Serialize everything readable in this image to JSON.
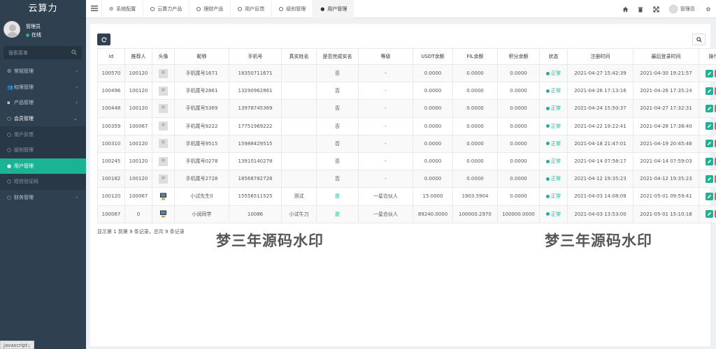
{
  "brand": "云算力",
  "user": {
    "name": "管理员",
    "status": "在线"
  },
  "sidebar": {
    "search_placeholder": "搜索菜单",
    "items": [
      {
        "label": "常规管理",
        "icon": "cogs-icon"
      },
      {
        "label": "权限管理",
        "icon": "users-icon"
      },
      {
        "label": "产品管理",
        "icon": "folder-icon"
      },
      {
        "label": "会员管理",
        "icon": "circle-icon"
      },
      {
        "label": "用户反馈",
        "icon": "circle-icon"
      },
      {
        "label": "级别管理",
        "icon": "circle-icon"
      },
      {
        "label": "用户管理",
        "icon": "user-icon"
      },
      {
        "label": "短信验证码",
        "icon": "circle-icon"
      },
      {
        "label": "财务管理",
        "icon": "circle-icon"
      }
    ]
  },
  "tabs": [
    {
      "label": "系统配置",
      "icon": "gear-icon"
    },
    {
      "label": "云算力产品",
      "icon": "circle-icon"
    },
    {
      "label": "理财产品",
      "icon": "circle-icon"
    },
    {
      "label": "用户反馈",
      "icon": "circle-icon"
    },
    {
      "label": "级别管理",
      "icon": "circle-icon"
    },
    {
      "label": "用户管理",
      "icon": "user-icon"
    }
  ],
  "topbar": {
    "user_label": "管理员"
  },
  "table": {
    "headers": [
      "Id",
      "推荐人",
      "头像",
      "昵称",
      "手机号",
      "真实姓名",
      "是否完成实名",
      "等级",
      "USDT余额",
      "FIL余额",
      "积分余额",
      "状态",
      "注册时间",
      "最后登录时间",
      "操作"
    ],
    "rows": [
      [
        "100570",
        "100120",
        "",
        "手机尾号1671",
        "18350711671",
        "",
        "否",
        "-",
        "0.0000",
        "0.0000",
        "0.0000",
        "正常",
        "2021-04-27 15:42:39",
        "2021-04-30 19:21:57"
      ],
      [
        "100496",
        "100120",
        "",
        "手机尾号2861",
        "13290962861",
        "",
        "否",
        "-",
        "0.0000",
        "0.0000",
        "0.0000",
        "正常",
        "2021-04-26 17:13:16",
        "2021-04-26 17:35:24"
      ],
      [
        "100448",
        "100120",
        "",
        "手机尾号5369",
        "13978745369",
        "",
        "否",
        "-",
        "0.0000",
        "0.0000",
        "0.0000",
        "正常",
        "2021-04-24 15:50:37",
        "2021-04-27 17:32:31"
      ],
      [
        "100359",
        "100067",
        "",
        "手机尾号9222",
        "17751969222",
        "",
        "否",
        "-",
        "0.0000",
        "0.0000",
        "0.0000",
        "正常",
        "2021-04-22 19:22:41",
        "2021-04-28 17:38:40"
      ],
      [
        "100310",
        "100120",
        "",
        "手机尾号9515",
        "15988429515",
        "",
        "否",
        "-",
        "0.0000",
        "0.0000",
        "0.0000",
        "正常",
        "2021-04-18 21:47:01",
        "2021-04-19 20:45:46"
      ],
      [
        "100245",
        "100120",
        "",
        "手机尾号0278",
        "13910140278",
        "",
        "否",
        "-",
        "0.0000",
        "0.0000",
        "0.0000",
        "正常",
        "2021-04-14 07:58:17",
        "2021-04-14 07:59:03"
      ],
      [
        "100182",
        "100120",
        "",
        "手机尾号2728",
        "18568782728",
        "",
        "否",
        "-",
        "0.0000",
        "0.0000",
        "0.0000",
        "正常",
        "2021-04-12 19:35:23",
        "2021-04-12 19:35:23"
      ],
      [
        "100120",
        "100067",
        "",
        "小试先生0",
        "15556511525",
        "测试",
        "是",
        "一星合伙人",
        "15.0000",
        "1903.5904",
        "0.0000",
        "正常",
        "2021-04-03 14:08:09",
        "2021-05-01 09:59:41"
      ],
      [
        "100067",
        "0",
        "",
        "小润同学",
        "10086",
        "小试牛刀",
        "是",
        "一星合伙人",
        "89240.0000",
        "100000.2970",
        "100000.0000",
        "正常",
        "2021-04-03 13:53:00",
        "2021-05-01 15:10:18"
      ]
    ],
    "avatar_types": [
      "default",
      "default",
      "default",
      "default",
      "default",
      "default",
      "default",
      "pc",
      "pc"
    ]
  },
  "pager_text": "显示第 1 到第 9 条记录，总共 9 条记录",
  "watermark": "梦三年源码水印",
  "statusbar": "javascript:;",
  "colors": {
    "sidebar": "#2f4050",
    "accent": "#1ab394",
    "danger": "#ed5565"
  }
}
